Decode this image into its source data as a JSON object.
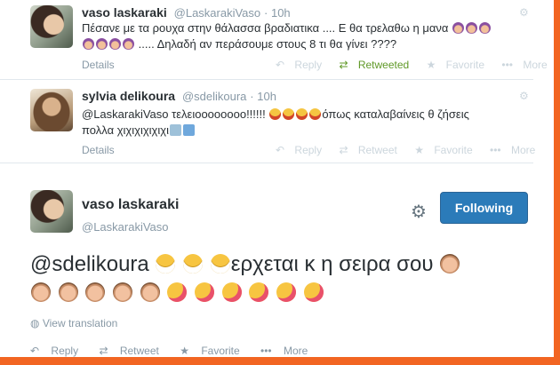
{
  "tweets": [
    {
      "name": "vaso laskaraki",
      "handle": "@LaskarakiVaso",
      "time": "· 10h",
      "text_line1": "Πέσανε με τα ρουχα στην θάλασσα βραδιατικα .... Ε θα τρελαθω η μανα",
      "text_line2": "..... Δηλαδή αν περάσουμε στους 8 τι θα γίνει ????",
      "details": "Details",
      "actions": {
        "reply": "Reply",
        "retweet": "Retweeted",
        "favorite": "Favorite",
        "more": "More"
      }
    },
    {
      "name": "sylvia delikoura",
      "handle": "@sdelikoura",
      "time": "· 10h",
      "text_line1": "@LaskarakiVaso τελειοοοοοοοο!!!!!!",
      "text_line1b": "όπως καταλαβαίνεις θ ζήσεις",
      "text_line2": "πολλα χιχιχιχιχιχι",
      "details": "Details",
      "actions": {
        "reply": "Reply",
        "retweet": "Retweet",
        "favorite": "Favorite",
        "more": "More"
      }
    }
  ],
  "permalink": {
    "name": "vaso laskaraki",
    "handle": "@LaskarakiVaso",
    "follow_label": "Following",
    "text_part1": "@sdelikoura",
    "text_part2": "ερχεται κ η σειρα σου",
    "view_translation": "View translation",
    "actions": {
      "reply": "Reply",
      "retweet": "Retweet",
      "favorite": "Favorite",
      "more": "More"
    }
  },
  "colors": {
    "accent_blue": "#2b7bb9",
    "frame_orange": "#f26522",
    "retweeted_green": "#609928"
  },
  "icons": [
    "reply-icon",
    "retweet-icon",
    "favorite-icon",
    "more-icon",
    "gear-icon",
    "globe-icon"
  ]
}
